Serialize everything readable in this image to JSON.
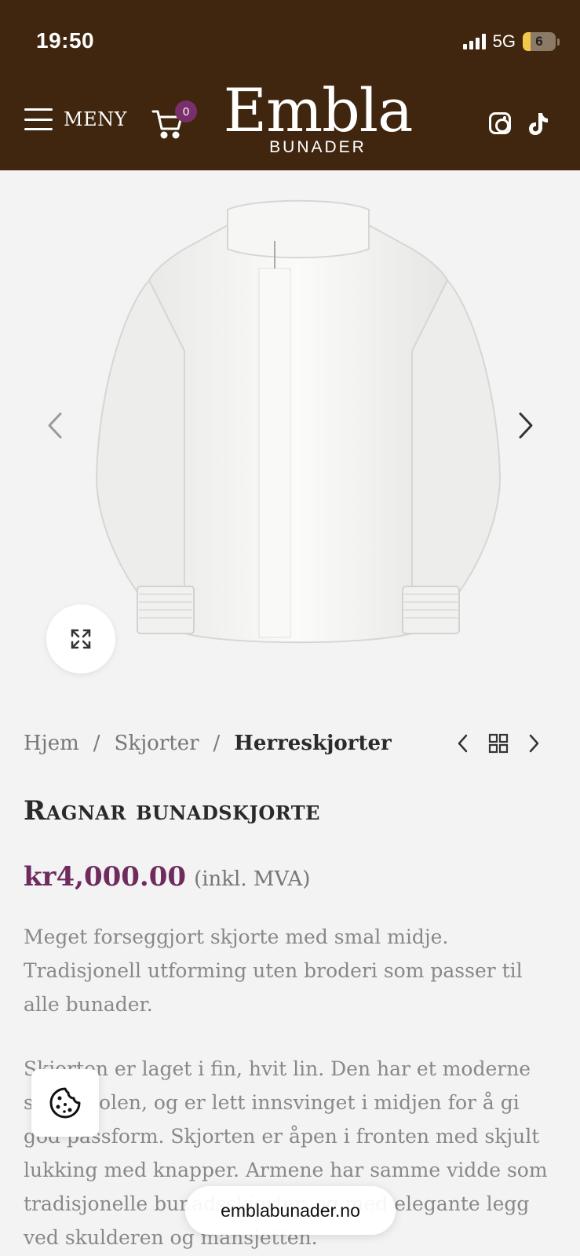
{
  "status_bar": {
    "time": "19:50",
    "network": "5G",
    "battery": "6"
  },
  "header": {
    "menu_label": "MENY",
    "cart_count": "0",
    "logo_main": "Embla",
    "logo_sub": "BUNADER",
    "icons": [
      "hamburger-icon",
      "cart-icon",
      "instagram-icon",
      "tiktok-icon"
    ]
  },
  "gallery": {
    "image": "white-linen-shirt",
    "controls": [
      "chevron-left-icon",
      "chevron-right-icon",
      "expand-icon"
    ]
  },
  "breadcrumb": {
    "items": [
      "Hjem",
      "Skjorter"
    ],
    "separator": "/",
    "current": "Herreskjorter"
  },
  "product": {
    "title": "Ragnar bunadskjorte",
    "price": "kr4,000.00",
    "price_note": "(inkl. MVA)",
    "description_1": "Meget forseggjort skjorte med smal midje. Tradisjonell utforming uten broderi som passer til alle bunader.",
    "description_2": "Skjorten er laget i fin, hvit lin. Den har et moderne snitt i kolen, og er lett innsvinget i midjen for å gi god passform. Skjorten er åpen i fronten med skjult lukking med knapper. Armene har samme vidde som tradisjonelle bunadsskjorter, og med elegante legg ved skulderen og mansjetten."
  },
  "browser": {
    "url": "emblabunader.no"
  },
  "colors": {
    "header_bg": "#41260f",
    "price": "#6f2a5e",
    "badge": "#7a2f6c"
  }
}
